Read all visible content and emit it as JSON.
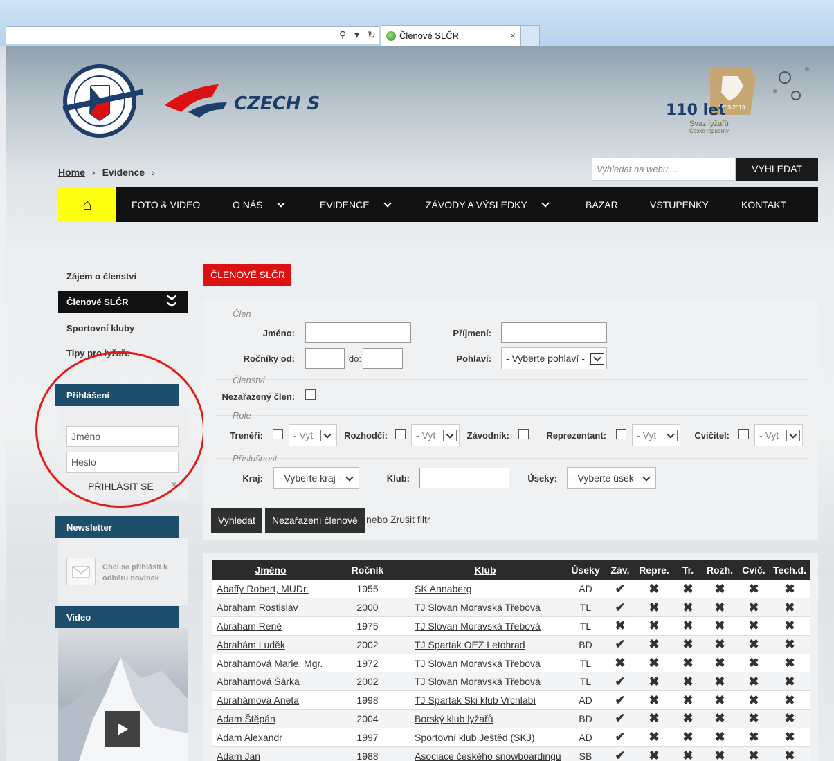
{
  "browser": {
    "tab_title": "Členové SLČR",
    "tab_close": "×",
    "addr_controls": "⚲ ▾ ↻"
  },
  "brand": {
    "name": "CZECH SKI",
    "badge_main": "110 let",
    "badge_years": "1903-2013",
    "badge_org": "Svaz lyžařů",
    "badge_org2": "České republiky"
  },
  "breadcrumb": {
    "home": "Home",
    "sep": "›",
    "current": "Evidence"
  },
  "search": {
    "placeholder": "Vyhledat na webu,...",
    "button": "VYHLEDAT"
  },
  "nav": {
    "home_icon": "⌂",
    "items": [
      "FOTO & VIDEO",
      "O NÁS",
      "EVIDENCE",
      "ZÁVODY A VÝSLEDKY",
      "BAZAR",
      "VSTUPENKY",
      "KONTAKT"
    ]
  },
  "sidebar": {
    "items": [
      "Zájem o členství",
      "Členové SLČR",
      "Sportovní kluby",
      "Tipy pro lyžaře"
    ],
    "active_marker": "❯❯",
    "login_head": "Přihlášení",
    "login_user_placeholder": "Jméno",
    "login_pass_placeholder": "Heslo",
    "login_button": "PŘIHLÁSIT SE",
    "login_x": "✕",
    "newsletter_head": "Newsletter",
    "newsletter_text": "Chci se přihlásit k odběru novinek",
    "video_head": "Video"
  },
  "main": {
    "title": "ČLENOVÉ SLČR",
    "filter": {
      "legend_clen": "Člen",
      "jmeno": "Jméno:",
      "prijmeni": "Příjmení:",
      "rocniky_od": "Ročníky od:",
      "do": "do:",
      "pohlavi": "Pohlaví:",
      "pohlavi_value": "- Vyberte pohlaví -",
      "legend_clenstvi": "Členství",
      "nezarazeny": "Nezařazený člen:",
      "legend_role": "Role",
      "treneri": "Trenéři:",
      "rozhodci": "Rozhodčí:",
      "zavodnik": "Závodník:",
      "reprezentant": "Reprezentant:",
      "cvicitel": "Cvičitel:",
      "role_select": "- Vyt",
      "legend_prislusnost": "Příslušnost",
      "kraj": "Kraj:",
      "kraj_value": "- Vyberte kraj -",
      "klub": "Klub:",
      "useky": "Úseky:",
      "useky_value": "- Vyberte úsek"
    },
    "buttons": {
      "search": "Vyhledat",
      "unassigned": "Nezařazení členové",
      "nebo": "nebo",
      "cancel": "Zrušit filtr"
    }
  },
  "table": {
    "headers": [
      "Jméno",
      "Ročník",
      "Klub",
      "Úseky",
      "Záv.",
      "Repre.",
      "Tr.",
      "Rozh.",
      "Cvič.",
      "Tech.d."
    ],
    "ok": "✔",
    "no": "✖",
    "rows": [
      {
        "name": "Abaffy Robert, MUDr.",
        "year": "1955",
        "club": "SK Annaberg",
        "sect": "AD",
        "zav": true
      },
      {
        "name": "Abraham Rostislav",
        "year": "2000",
        "club": "TJ Slovan Moravská Třebová",
        "sect": "TL",
        "zav": true
      },
      {
        "name": "Abraham René",
        "year": "1975",
        "club": "TJ Slovan Moravská Třebová",
        "sect": "TL",
        "zav": false
      },
      {
        "name": "Abrahám Luděk",
        "year": "2002",
        "club": "TJ Spartak OEZ Letohrad",
        "sect": "BD",
        "zav": true
      },
      {
        "name": "Abrahamová Marie, Mgr.",
        "year": "1972",
        "club": "TJ Slovan Moravská Třebová",
        "sect": "TL",
        "zav": false
      },
      {
        "name": "Abrahamová Šárka",
        "year": "2002",
        "club": "TJ Slovan Moravská Třebová",
        "sect": "TL",
        "zav": true
      },
      {
        "name": "Abrahámová Aneta",
        "year": "1998",
        "club": "TJ Spartak Ski klub Vrchlabí",
        "sect": "AD",
        "zav": true
      },
      {
        "name": "Adam Štěpán",
        "year": "2004",
        "club": "Borský klub lyžařů",
        "sect": "BD",
        "zav": true
      },
      {
        "name": "Adam Alexandr",
        "year": "1997",
        "club": "Sportovní klub Ještěd (SKJ)",
        "sect": "AD",
        "zav": true
      },
      {
        "name": "Adam Jan",
        "year": "1988",
        "club": "Asociace českého snowboardingu",
        "sect": "SB",
        "zav": true
      }
    ]
  },
  "colors": {
    "accent_red": "#dd1111",
    "nav_yellow": "#ffff11",
    "panel_blue": "#1d4e6b",
    "ok_green": "#5aae2f",
    "no_red": "#e31b1b"
  }
}
